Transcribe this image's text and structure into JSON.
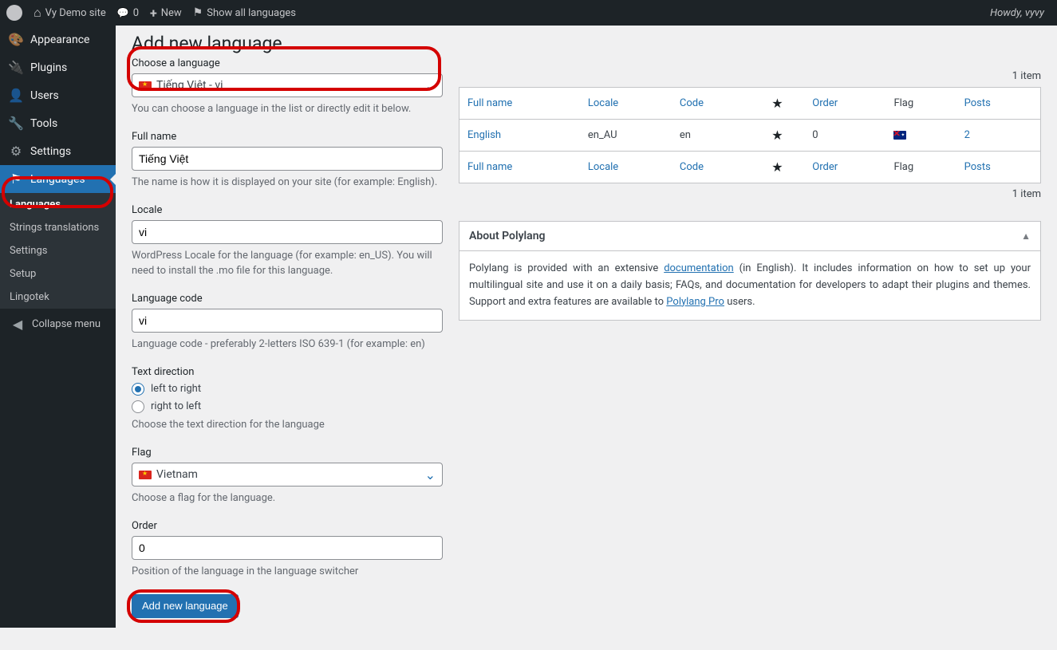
{
  "adminbar": {
    "site_name": "Vy Demo site",
    "comments": "0",
    "new": "New",
    "show_all": "Show all languages",
    "howdy": "Howdy, vyvy"
  },
  "sidebar": {
    "items": [
      {
        "icon": "🎨",
        "label": "Appearance"
      },
      {
        "icon": "🔌",
        "label": "Plugins"
      },
      {
        "icon": "👤",
        "label": "Users"
      },
      {
        "icon": "🔧",
        "label": "Tools"
      },
      {
        "icon": "⚙",
        "label": "Settings"
      },
      {
        "icon": "⚑",
        "label": "Languages",
        "active": true
      }
    ],
    "submenu": [
      "Languages",
      "Strings translations",
      "Settings",
      "Setup",
      "Lingotek"
    ],
    "collapse": "Collapse menu"
  },
  "page": {
    "title": "Add new language",
    "choose_label": "Choose a language",
    "choose_value": "Tiếng Việt - vi",
    "choose_desc": "You can choose a language in the list or directly edit it below.",
    "fullname_label": "Full name",
    "fullname_value": "Tiếng Việt",
    "fullname_desc": "The name is how it is displayed on your site (for example: English).",
    "locale_label": "Locale",
    "locale_value": "vi",
    "locale_desc": "WordPress Locale for the language (for example: en_US). You will need to install the .mo file for this language.",
    "code_label": "Language code",
    "code_value": "vi",
    "code_desc": "Language code - preferably 2-letters ISO 639-1 (for example: en)",
    "dir_label": "Text direction",
    "dir_ltr": "left to right",
    "dir_rtl": "right to left",
    "dir_desc": "Choose the text direction for the language",
    "flag_label": "Flag",
    "flag_value": "Vietnam",
    "flag_desc": "Choose a flag for the language.",
    "order_label": "Order",
    "order_value": "0",
    "order_desc": "Position of the language in the language switcher",
    "submit": "Add new language"
  },
  "table": {
    "items_text": "1 item",
    "headers": {
      "fullname": "Full name",
      "locale": "Locale",
      "code": "Code",
      "order": "Order",
      "flag": "Flag",
      "posts": "Posts"
    },
    "rows": [
      {
        "fullname": "English",
        "locale": "en_AU",
        "code": "en",
        "star": "★",
        "order": "0",
        "flag": "au",
        "posts": "2"
      }
    ]
  },
  "about": {
    "title": "About Polylang",
    "text_1": "Polylang is provided with an extensive ",
    "doc_link": "documentation",
    "text_2": " (in English). It includes information on how to set up your multilingual site and use it on a daily basis; FAQs, and documentation for developers to adapt their plugins and themes. Support and extra features are available to ",
    "pro_link": "Polylang Pro",
    "text_3": " users."
  }
}
